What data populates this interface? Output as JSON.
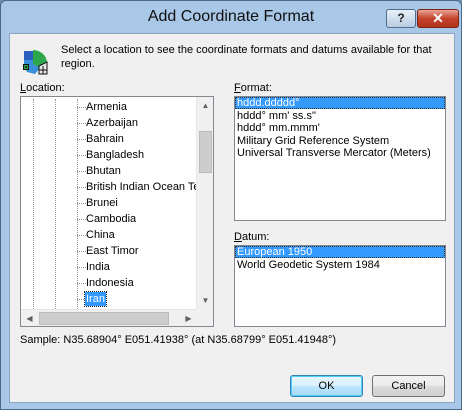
{
  "window": {
    "title": "Add Coordinate Format",
    "help_label": "?",
    "close_label": "✕"
  },
  "intro_text": "Select a location to see the coordinate formats and datums available for that region.",
  "location": {
    "label_accel": "L",
    "label_rest": "ocation:",
    "items": [
      {
        "label": "Armenia"
      },
      {
        "label": "Azerbaijan"
      },
      {
        "label": "Bahrain"
      },
      {
        "label": "Bangladesh"
      },
      {
        "label": "Bhutan"
      },
      {
        "label": "British Indian Ocean Ter"
      },
      {
        "label": "Brunei"
      },
      {
        "label": "Cambodia"
      },
      {
        "label": "China"
      },
      {
        "label": "East Timor"
      },
      {
        "label": "India"
      },
      {
        "label": "Indonesia"
      },
      {
        "label": "Iran"
      }
    ],
    "selected": "Iran"
  },
  "format": {
    "label_accel": "F",
    "label_rest": "ormat:",
    "items": [
      {
        "label": "hddd.ddddd°"
      },
      {
        "label": "hddd° mm' ss.s\""
      },
      {
        "label": "hddd° mm.mmm'"
      },
      {
        "label": "Military Grid Reference System"
      },
      {
        "label": "Universal Transverse Mercator (Meters)"
      }
    ],
    "selected": "hddd.ddddd°"
  },
  "datum": {
    "label_accel": "D",
    "label_rest": "atum:",
    "items": [
      {
        "label": "European 1950"
      },
      {
        "label": "World Geodetic System 1984"
      }
    ],
    "selected": "European 1950"
  },
  "sample_text": "Sample: N35.68904°  E051.41938° (at N35.68799°  E051.41948°)",
  "buttons": {
    "ok": "OK",
    "cancel": "Cancel"
  }
}
